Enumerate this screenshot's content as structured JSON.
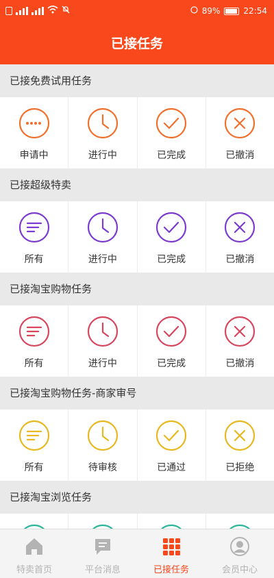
{
  "status_bar": {
    "battery": "89%",
    "time": "22:54"
  },
  "header": {
    "title": "已接任务"
  },
  "colors": {
    "orange": "#f26f2b",
    "purple": "#7b3bd0",
    "red": "#d8465e",
    "yellow": "#e8b81f",
    "teal": "#2bb59a",
    "brand": "#f8481c"
  },
  "sections": [
    {
      "title": "已接免费试用任务",
      "color": "#f26f2b",
      "items": [
        {
          "icon": "dots-icon",
          "label": "申请中"
        },
        {
          "icon": "clock-icon",
          "label": "进行中"
        },
        {
          "icon": "check-icon",
          "label": "已完成"
        },
        {
          "icon": "cross-icon",
          "label": "已撤消"
        }
      ]
    },
    {
      "title": "已接超级特卖",
      "color": "#7b3bd0",
      "items": [
        {
          "icon": "list-icon",
          "label": "所有"
        },
        {
          "icon": "clock-icon",
          "label": "进行中"
        },
        {
          "icon": "check-icon",
          "label": "已完成"
        },
        {
          "icon": "cross-icon",
          "label": "已撤消"
        }
      ]
    },
    {
      "title": "已接淘宝购物任务",
      "color": "#d8465e",
      "items": [
        {
          "icon": "list-icon",
          "label": "所有"
        },
        {
          "icon": "clock-icon",
          "label": "进行中"
        },
        {
          "icon": "check-icon",
          "label": "已完成"
        },
        {
          "icon": "cross-icon",
          "label": "已撤消"
        }
      ]
    },
    {
      "title": "已接淘宝购物任务-商家审号",
      "color": "#e8b81f",
      "items": [
        {
          "icon": "list-icon",
          "label": "所有"
        },
        {
          "icon": "clock-icon",
          "label": "待审核"
        },
        {
          "icon": "check-icon",
          "label": "已通过"
        },
        {
          "icon": "cross-icon",
          "label": "已拒绝"
        }
      ]
    },
    {
      "title": "已接淘宝浏览任务",
      "color": "#2bb59a",
      "items": []
    }
  ],
  "tabbar": [
    {
      "icon": "home-icon",
      "label": "特卖首页",
      "active": false
    },
    {
      "icon": "message-icon",
      "label": "平台消息",
      "active": false
    },
    {
      "icon": "grid-icon",
      "label": "已接任务",
      "active": true
    },
    {
      "icon": "user-icon",
      "label": "会员中心",
      "active": false
    }
  ]
}
